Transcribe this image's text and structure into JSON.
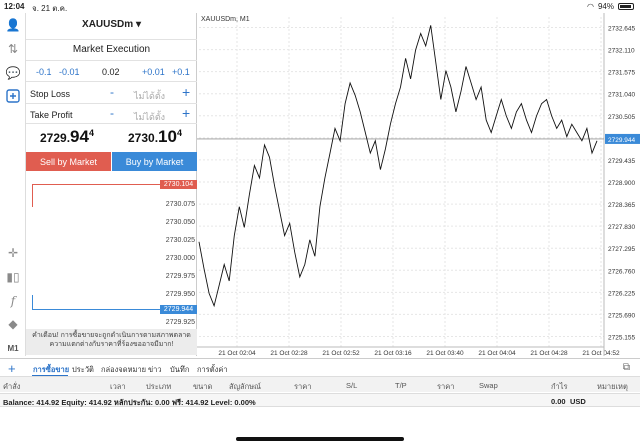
{
  "status": {
    "time": "12:04",
    "date": "จ. 21 ต.ค.",
    "battery": "94%",
    "battery_level": 0.94
  },
  "toolbar": {
    "icons": [
      "person-icon",
      "transfer-icon",
      "chat-icon",
      "new-order-icon",
      "crosshair-icon",
      "candles-icon",
      "function-icon",
      "objects-icon",
      "timeframe-label"
    ],
    "timeframe": "M1"
  },
  "order": {
    "symbol": "XAUUSDm",
    "symbol_caret": "▾",
    "execution": "Market Execution",
    "volume": {
      "dec2": "-0.1",
      "dec1": "-0.01",
      "value": "0.02",
      "inc1": "+0.01",
      "inc2": "+0.1"
    },
    "stop_loss": {
      "label": "Stop Loss",
      "minus": "-",
      "value": "ไม่ได้ตั้ง",
      "plus": "+"
    },
    "take_profit": {
      "label": "Take Profit",
      "minus": "-",
      "value": "ไม่ได้ตั้ง",
      "plus": "+"
    },
    "bid": {
      "main": "2729.",
      "big": "94",
      "sup": "4"
    },
    "ask": {
      "main": "2730.",
      "big": "10",
      "sup": "4"
    },
    "sell_label": "Sell by Market",
    "buy_label": "Buy by Market",
    "depth_ticks": [
      "2730.075",
      "2730.050",
      "2730.025",
      "2730.000",
      "2729.975",
      "2729.950",
      "2729.925"
    ],
    "depth_ask_label": "2730.104",
    "depth_bid_label": "2729.944",
    "warning": "คำเตือน! การซื้อขายจะถูกดำเนินการตามสภาพตลาด ความแตกต่างกับราคาที่ร้องขออาจมีมาก!"
  },
  "chart_data": {
    "type": "line",
    "title": "XAUUSDm, M1",
    "x_labels": [
      "21 Oct 02:04",
      "21 Oct 02:28",
      "21 Oct 02:52",
      "21 Oct 03:16",
      "21 Oct 03:40",
      "21 Oct 04:04",
      "21 Oct 04:28",
      "21 Oct 04:52"
    ],
    "y_ticks": [
      "2732.645",
      "2732.110",
      "2731.575",
      "2731.040",
      "2730.505",
      "2729.970",
      "2729.435",
      "2728.900",
      "2728.365",
      "2727.830",
      "2727.295",
      "2726.760",
      "2726.225",
      "2725.690",
      "2725.155"
    ],
    "ylim": [
      2724.9,
      2732.9
    ],
    "current_price": 2729.944,
    "current_label": "2729.944",
    "values": [
      2727.45,
      2726.8,
      2726.2,
      2725.9,
      2726.4,
      2726.9,
      2726.5,
      2727.6,
      2728.3,
      2727.8,
      2728.6,
      2729.3,
      2729.0,
      2729.8,
      2729.5,
      2728.8,
      2728.2,
      2727.6,
      2727.9,
      2727.2,
      2726.6,
      2726.9,
      2727.5,
      2727.1,
      2728.3,
      2729.0,
      2729.6,
      2730.2,
      2729.9,
      2730.8,
      2731.3,
      2731.0,
      2730.6,
      2730.1,
      2729.6,
      2729.9,
      2729.2,
      2729.7,
      2730.3,
      2730.8,
      2731.2,
      2731.9,
      2731.4,
      2732.1,
      2732.5,
      2732.2,
      2732.7,
      2731.8,
      2730.9,
      2731.6,
      2731.2,
      2730.6,
      2731.1,
      2731.7,
      2731.3,
      2730.9,
      2731.2,
      2730.4,
      2730.1,
      2730.5,
      2730.9,
      2730.5,
      2730.2,
      2730.6,
      2730.8,
      2730.4,
      2730.1,
      2730.5,
      2730.8,
      2730.9,
      2730.5,
      2730.2,
      2730.4,
      2730.0,
      2730.3,
      2730.1,
      2729.9,
      2730.2,
      2729.6,
      2729.9
    ]
  },
  "tabs": {
    "add": "+",
    "items": [
      "การซื้อขาย",
      "ประวัติ",
      "กล่องจดหมาย",
      "ข่าว",
      "บันทึก",
      "การตั้งค่า"
    ],
    "active": "การซื้อขาย"
  },
  "table_headers": [
    "คำสั่ง",
    "เวลา",
    "ประเภท",
    "ขนาด",
    "สัญลักษณ์",
    "ราคา",
    "S/L",
    "T/P",
    "ราคา",
    "Swap",
    "กำไร",
    "หมายเหตุ"
  ],
  "balance": {
    "text": "Balance: 414.92 Equity: 414.92 หลักประกัน: 0.00 ฟรี: 414.92 Level: 0.00%",
    "profit": "0.00",
    "currency": "USD"
  }
}
